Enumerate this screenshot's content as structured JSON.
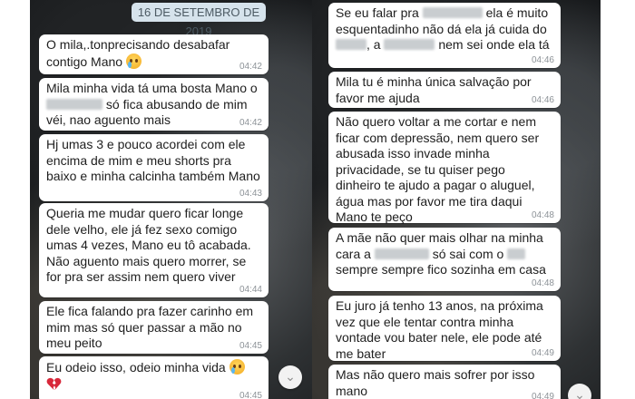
{
  "left": {
    "date_label": "16 DE SETEMBRO DE 2019",
    "messages": [
      {
        "text": "O mila,.tonprecisando desabafar contigo Mano",
        "time": "04:42"
      },
      {
        "pre": "Mila minha vida tá uma bosta Mano o",
        "post": "só fica abusando de mim véi, nao aguento mais",
        "time": "04:42"
      },
      {
        "text": "Hj umas 3 e pouco acordei com ele encima de mim e meu shorts pra baixo e minha calcinha também Mano",
        "time": "04:43"
      },
      {
        "text": "Queria me mudar quero ficar longe dele velho, ele já fez sexo comigo umas 4 vezes, Mano eu tô acabada. Não aguento mais quero morrer, se for pra ser assim nem quero viver",
        "time": "04:44"
      },
      {
        "text": "Ele fica falando pra fazer carinho em mim mas só quer passar a mão no meu peito",
        "time": "04:45"
      },
      {
        "text": "Eu odeio isso, odeio minha vida",
        "time": "04:45"
      }
    ]
  },
  "right": {
    "messages": [
      {
        "line1_pre": "Se eu falar pra",
        "line1_post": "ela é muito",
        "line2_pre": "esquentadinho não dá ela já cuida do",
        "line3_mid": ", a",
        "line3_post": "nem sei onde ela tá",
        "time": "04:46"
      },
      {
        "text": "Mila tu é minha única salvação por favor me ajuda",
        "time": "04:46"
      },
      {
        "text": "Não quero voltar a me cortar e nem ficar com depressão, nem quero ser abusada isso invade minha privacidade, se tu quiser pego dinheiro te ajudo a pagar o aluguel, água mas por favor me tira daqui Mano te peço",
        "time": "04:48"
      },
      {
        "line1": "A mãe não quer mais olhar na minha",
        "line2_pre": "cara a",
        "line2_mid": "só sai com o",
        "line3": "sempre sempre fico sozinha em casa",
        "time": "04:48"
      },
      {
        "text": "Eu juro já tenho 13 anos, na próxima vez que ele tentar contra minha vontade vou bater nele, ele pode até me bater",
        "time": "04:49"
      },
      {
        "text": "Mas não quero mais sofrer por isso mano",
        "time": "04:49"
      }
    ]
  },
  "icons": {
    "crying": "crying-face-icon",
    "broken_heart": "broken-heart-icon",
    "scroll_down": "chevron-down-icon"
  },
  "colors": {
    "bubble": "#ffffff",
    "date_pill": "#d6e3ec",
    "timestamp": "#8d9398",
    "heart": "#d8283a"
  }
}
